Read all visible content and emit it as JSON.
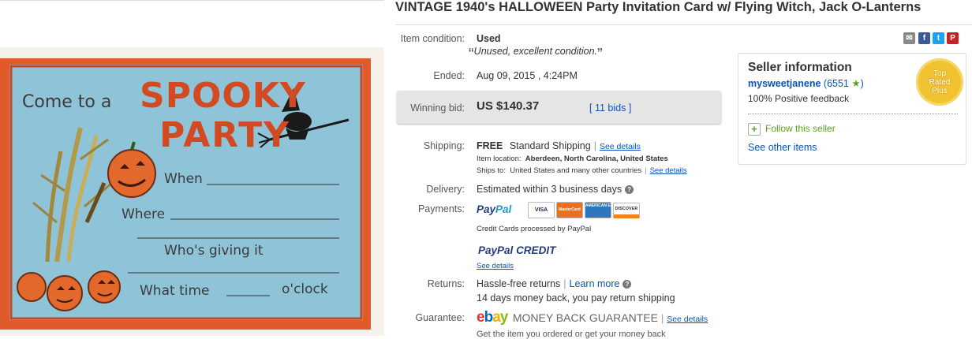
{
  "listing": {
    "title": "VINTAGE 1940's HALLOWEEN Party Invitation Card w/ Flying Witch, Jack O-Lanterns"
  },
  "card_image": {
    "line1": "Come to a",
    "spooky": "SPOOKY",
    "party": "PARTY",
    "when": "When",
    "where": "Where",
    "whos_giving": "Who's giving it",
    "what_time": "What time",
    "oclock": "o'clock"
  },
  "details": {
    "condition_label": "Item condition:",
    "condition_value": "Used",
    "condition_note": "Unused, excellent condition.",
    "ended_label": "Ended:",
    "ended_value": "Aug 09, 2015 , 4:24PM",
    "winning_label": "Winning bid:",
    "winning_value": "US $140.37",
    "bids_link": "11 bids",
    "shipping_label": "Shipping:",
    "shipping_free": "FREE",
    "shipping_method": "Standard Shipping",
    "see_details": "See details",
    "item_location_label": "Item location:",
    "item_location_value": "Aberdeen, North Carolina, United States",
    "ships_to_label": "Ships to:",
    "ships_to_value": "United States and many other countries",
    "delivery_label": "Delivery:",
    "delivery_value": "Estimated within 3 business days",
    "payments_label": "Payments:",
    "paypal_a": "Pay",
    "paypal_b": "Pal",
    "credit_note": "Credit Cards processed by PayPal",
    "paypal_credit_a": "PayPal",
    "paypal_credit_b": "CREDIT",
    "returns_label": "Returns:",
    "returns_value": "Hassle-free returns",
    "learn_more": "Learn more",
    "returns_note": "14 days money back, you pay return shipping",
    "guarantee_label": "Guarantee:",
    "guarantee_text": "MONEY BACK GUARANTEE",
    "guarantee_cut": "Get the item you ordered or get your money back"
  },
  "card_logos": [
    "VISA",
    "MasterCard",
    "AMERICAN EXPRESS",
    "DISCOVER"
  ],
  "seller": {
    "heading": "Seller information",
    "username": "mysweetjanene",
    "feedback_count": "6551",
    "positive": "100% Positive feedback",
    "follow": "Follow this seller",
    "other_items": "See other items",
    "badge_line1": "Top",
    "badge_line2": "Rated",
    "badge_line3": "Plus"
  },
  "colors": {
    "link": "#0654ba",
    "card_border": "#e25a2c",
    "card_background": "#8fc3d8"
  }
}
